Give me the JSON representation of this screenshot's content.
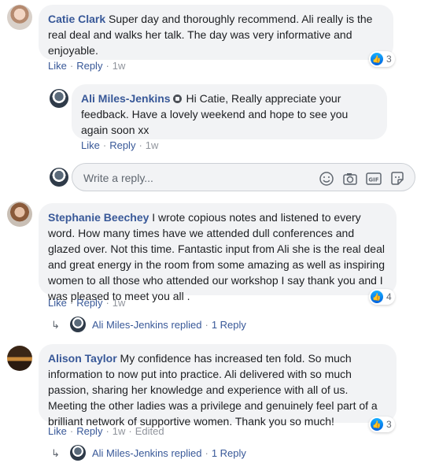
{
  "comments": [
    {
      "author": "Catie Clark",
      "text": "Super day and thoroughly recommend. Ali really is the real deal and walks her talk. The day was very informative and enjoyable.",
      "like": "Like",
      "reply": "Reply",
      "time": "1w",
      "reactions": "3"
    },
    {
      "author": "Stephanie Beechey",
      "text": "I wrote copious notes and listened to every word. How many times have we attended dull conferences and glazed over. Not this time. Fantastic input from Ali she is the real deal and great energy in the room from some amazing as well as inspiring women to all those who attended our workshop I say thank you and I was pleased to meet you all .",
      "like": "Like",
      "reply": "Reply",
      "time": "1w",
      "reactions": "4"
    },
    {
      "author": "Alison Taylor",
      "text": "My confidence has increased ten fold. So much information to now put into practice. Ali delivered with so much passion, sharing her knowledge and experience with all of us. Meeting the other ladies was a privilege and genuinely feel part of a brilliant network of supportive women. Thank you so much!",
      "like": "Like",
      "reply": "Reply",
      "time": "1w",
      "edited": "Edited",
      "reactions": "3"
    }
  ],
  "reply1": {
    "author": "Ali Miles-Jenkins",
    "text": "Hi Catie, Really appreciate your feedback. Have a lovely weekend and hope to see you again soon xx",
    "like": "Like",
    "reply": "Reply",
    "time": "1w"
  },
  "composer": {
    "placeholder": "Write a reply..."
  },
  "replied_summary": {
    "author": "Ali Miles-Jenkins",
    "action": "replied",
    "count": "1 Reply"
  },
  "colors": {
    "link": "#385898",
    "bubble": "#f2f3f5",
    "meta": "#90949c",
    "like_blue": "#0062df"
  },
  "icons": [
    "verified-badge-icon",
    "like-icon",
    "emoji-icon",
    "camera-icon",
    "gif-icon",
    "sticker-icon",
    "reply-arrow-icon"
  ]
}
